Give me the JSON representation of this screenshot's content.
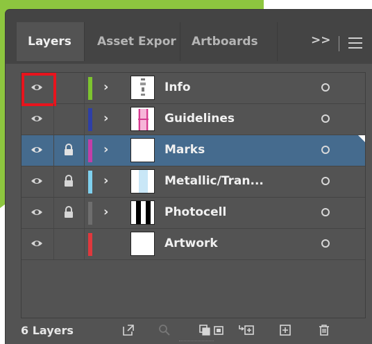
{
  "tabs": [
    {
      "label": "Layers"
    },
    {
      "label": "Asset Expor"
    },
    {
      "label": "Artboards"
    }
  ],
  "tab_overflow": ">>",
  "layers": [
    {
      "name": "Info",
      "color": "#7dc42f",
      "locked": false,
      "expandable": true,
      "thumb": "info"
    },
    {
      "name": "Guidelines",
      "color": "#2e3fa6",
      "locked": false,
      "expandable": true,
      "thumb": "guides"
    },
    {
      "name": "Marks",
      "color": "#c23ea8",
      "locked": true,
      "expandable": true,
      "thumb": "blank",
      "selected": true
    },
    {
      "name": "Metallic/Tran...",
      "color": "#7fd0ee",
      "locked": true,
      "expandable": true,
      "thumb": "metallic"
    },
    {
      "name": "Photocell",
      "color": "#6e6e6e",
      "locked": true,
      "expandable": true,
      "thumb": "photocell"
    },
    {
      "name": "Artwork",
      "color": "#e0383d",
      "locked": false,
      "expandable": false,
      "thumb": "blank"
    }
  ],
  "footer": {
    "count_label": "6 Layers",
    "icons": [
      "export-icon",
      "search-icon",
      "clipping-mask-icon",
      "collect-icon",
      "new-sublayer-icon",
      "new-layer-icon",
      "delete-icon"
    ]
  },
  "highlight_color": "#e8141d"
}
